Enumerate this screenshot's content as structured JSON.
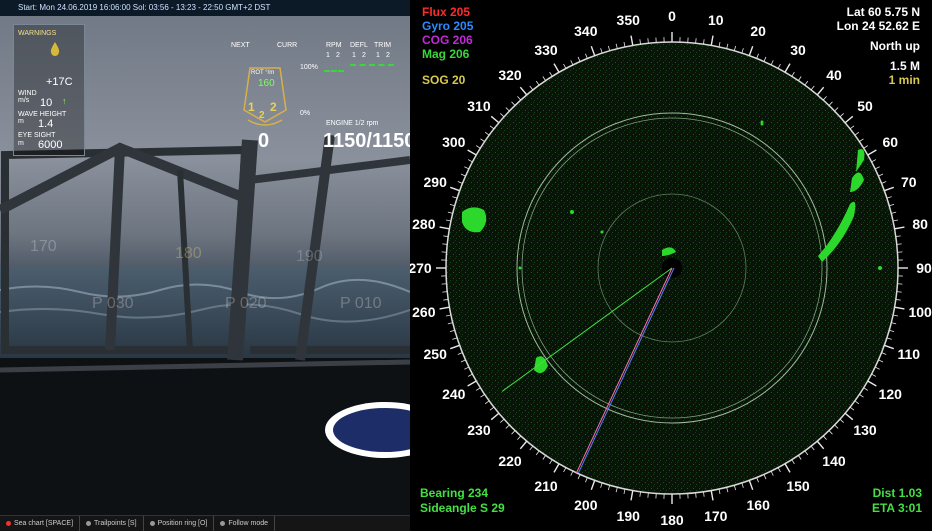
{
  "status_bar": {
    "text": "Start: Mon 24.06.2019  16:06:00  Sol: 03:56 - 13:23 - 22:50  GMT+2  DST"
  },
  "hud": {
    "warnings_label": "WARNINGS",
    "temperature": "+17C",
    "wind_label": "WIND",
    "wind_unit": "m/s",
    "wind_value": "10",
    "wave_label": "WAVE HEIGHT",
    "wave_unit": "m",
    "wave_value": "1.4",
    "eye_label": "EYE SIGHT",
    "eye_unit": "m",
    "eye_value": "6000",
    "next_label": "NEXT",
    "curr_label": "CURR",
    "rot_label": "ROT °/m",
    "rot_value": "160",
    "gear_left": "1",
    "gear_right": "2",
    "gear_bottom": "2",
    "percent_100": "100%",
    "percent_0": "0%",
    "rpm_label": "RPM",
    "defl_label": "DEFL",
    "trim_label": "TRIM",
    "col_1": "1",
    "col_2": "2",
    "engine_label": "ENGINE 1/2 rpm",
    "speed_value": "0",
    "engine_value": "1150/1150",
    "heading_marks": [
      "170",
      "180",
      "190"
    ],
    "bearing_marks": [
      "P 030",
      "P 020",
      "P 010"
    ]
  },
  "bottom_bar": [
    {
      "label": "Sea chart [SPACE]",
      "active": true
    },
    {
      "label": "Trailpoints [S]",
      "active": false
    },
    {
      "label": "Position ring [O]",
      "active": false
    },
    {
      "label": "Follow mode",
      "active": false
    }
  ],
  "radar": {
    "flux": "Flux 205",
    "gyro": "Gyro 205",
    "cog": "COG 206",
    "mag": "Mag 206",
    "sog": "SOG  20",
    "lat": "Lat 60 5.75 N",
    "lon": "Lon 24 52.62 E",
    "orientation": "North up",
    "range": "1.5 M",
    "trail": "1 min",
    "bearing": "Bearing 234",
    "sideangle": "Sideangle S 29",
    "dist": "Dist  1.03",
    "eta": "ETA 3:01",
    "compass_labels": [
      "0",
      "10",
      "20",
      "30",
      "40",
      "50",
      "60",
      "70",
      "80",
      "90",
      "100",
      "110",
      "120",
      "130",
      "140",
      "150",
      "160",
      "170",
      "180",
      "190",
      "200",
      "210",
      "220",
      "230",
      "240",
      "250",
      "260",
      "270",
      "280",
      "290",
      "300",
      "310",
      "320",
      "330",
      "340",
      "350"
    ],
    "bearing_deg": 234,
    "heading_deg": 205,
    "colors": {
      "flux": "#ff2a2a",
      "gyro": "#2a8cff",
      "cog": "#c02ad6",
      "mag": "#3ad63a",
      "sog": "#d8c850",
      "green": "#43e043",
      "white": "#ffffff"
    }
  }
}
